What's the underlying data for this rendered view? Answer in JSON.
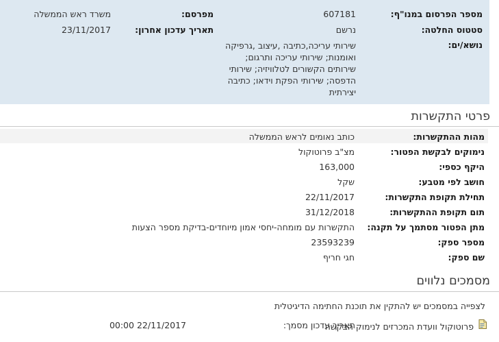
{
  "summary": {
    "publication_number_label": "מספר הפרסום במנו\"ף:",
    "publication_number": "607181",
    "publisher_label": "מפרסם:",
    "publisher": "משרד ראש הממשלה",
    "decision_status_label": "סטטוס החלטה:",
    "decision_status": "נרשם",
    "last_update_label": "תאריך עדכון אחרון:",
    "last_update": "23/11/2017",
    "topics_label": "נושא/ים:",
    "topics_lines": [
      "שירותי עריכה,כתיבה ,עיצוב ,גרפיקה",
      "ואומנות; שירותי עריכה ותרגום;",
      "שירותים הקשורים לטלוויזיה; שירותי",
      "הדפסה; שירותי הפקת וידאו; כתיבה",
      "יצירתית"
    ]
  },
  "contact": {
    "title": "פרטי התקשרות",
    "rows": [
      {
        "label": "מהות ההתקשרות:",
        "value": "כותב נאומים לראש הממשלה"
      },
      {
        "label": "נימוקים לבקשת הפטור:",
        "value": "מצ\"ב פרוטוקול"
      },
      {
        "label": "היקף כספי:",
        "value": "163,000"
      },
      {
        "label": "חושב לפי מטבע:",
        "value": "שקל"
      },
      {
        "label": "תחילת תקופת התקשרות:",
        "value": "22/11/2017"
      },
      {
        "label": "תום תקופת ההתקשרות:",
        "value": "31/12/2018"
      },
      {
        "label": "מתן הפטור מסתמך על תקנה:",
        "value": "התקשרות עם מומחה-יחסי אמון מיוחדים-בדיקת מספר הצעות"
      },
      {
        "label": "מספר ספק:",
        "value": "23593239"
      },
      {
        "label": "שם ספק:",
        "value": "חגי חריף"
      }
    ]
  },
  "documents": {
    "title": "מסמכים נלווים",
    "note": "לצפייה במסמכים יש להתקין את תוכנת החתימה הדיגיטלית",
    "items": [
      {
        "name": "פרוטוקול וועדת המכרזים לנימוק הבקשה",
        "update_label": "תאריך עדכון מסמך:",
        "update_value": "22/11/2017 00:00"
      }
    ]
  },
  "colors": {
    "summary_bg": "#dde8f1",
    "row_highlight": "#f3f3f3",
    "divider": "#c9c9c9"
  },
  "icons": {
    "document": "document-icon"
  }
}
